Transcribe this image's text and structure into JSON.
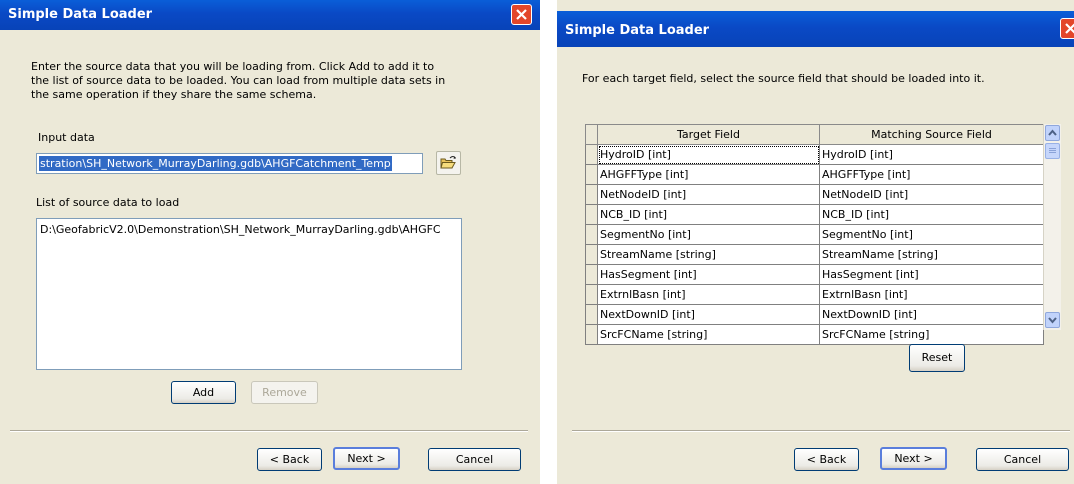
{
  "left_dialog": {
    "title": "Simple Data Loader",
    "instructions": [
      "Enter the source data that you will be loading from. Click Add to add it to",
      "the list of source data to be loaded. You can load from multiple data sets in",
      "the same operation if they share the same schema."
    ],
    "input_label": "Input data",
    "input_value": "stration\\SH_Network_MurrayDarling.gdb\\AHGFCatchment_Temp",
    "browse_icon": "open-folder-icon",
    "list_label": "List of source data to load",
    "list_items": [
      "D:\\GeofabricV2.0\\Demonstration\\SH_Network_MurrayDarling.gdb\\AHGFC"
    ],
    "add_label": "Add",
    "remove_label": "Remove",
    "back_label": "< Back",
    "next_label": "Next >",
    "cancel_label": "Cancel"
  },
  "right_dialog": {
    "title": "Simple Data Loader",
    "instructions": "For each target field, select the source field that should be loaded into it.",
    "grid": {
      "headers": [
        "Target Field",
        "Matching Source Field"
      ],
      "rows": [
        [
          "HydroID [int]",
          "HydroID [int]"
        ],
        [
          "AHGFFType [int]",
          "AHGFFType [int]"
        ],
        [
          "NetNodeID [int]",
          "NetNodeID [int]"
        ],
        [
          "NCB_ID [int]",
          "NCB_ID [int]"
        ],
        [
          "SegmentNo [int]",
          "SegmentNo [int]"
        ],
        [
          "StreamName [string]",
          "StreamName [string]"
        ],
        [
          "HasSegment [int]",
          "HasSegment [int]"
        ],
        [
          "ExtrnlBasn [int]",
          "ExtrnlBasn [int]"
        ],
        [
          "NextDownID [int]",
          "NextDownID [int]"
        ],
        [
          "SrcFCName [string]",
          "SrcFCName [string]"
        ]
      ]
    },
    "reset_label": "Reset",
    "back_label": "< Back",
    "next_label": "Next >",
    "cancel_label": "Cancel"
  },
  "colors": {
    "titlebar": "#0a49c5",
    "dialog_bg": "#ece9d8",
    "selection": "#316ac5",
    "close_button": "#e3462a"
  }
}
